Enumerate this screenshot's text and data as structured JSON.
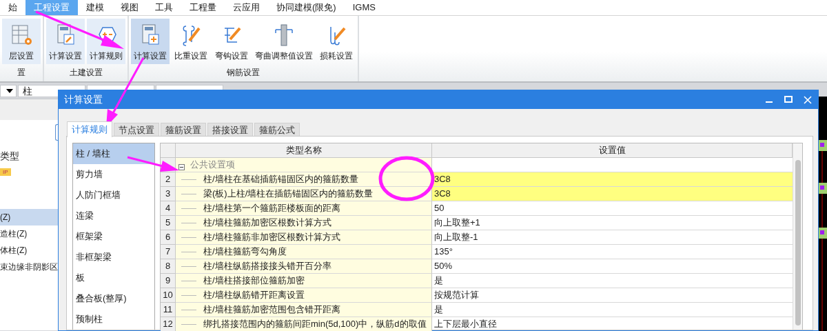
{
  "menu": [
    {
      "label": "始",
      "selected": false
    },
    {
      "label": "工程设置",
      "selected": true
    },
    {
      "label": "建模",
      "selected": false
    },
    {
      "label": "视图",
      "selected": false
    },
    {
      "label": "工具",
      "selected": false
    },
    {
      "label": "工程量",
      "selected": false
    },
    {
      "label": "云应用",
      "selected": false
    },
    {
      "label": "协同建模(限免)",
      "selected": false
    },
    {
      "label": "IGMS",
      "selected": false
    }
  ],
  "ribbon": {
    "groups": [
      {
        "label": "置",
        "buttons": [
          {
            "label": "层设置",
            "kind": "grid",
            "selected": false
          }
        ]
      },
      {
        "label": "土建设置",
        "buttons": [
          {
            "label": "计算设置",
            "kind": "wrench",
            "selected": false
          },
          {
            "label": "计算规则",
            "kind": "hexagon",
            "selected": false
          }
        ]
      },
      {
        "label": "钢筋设置",
        "buttons": [
          {
            "label": "计算设置",
            "kind": "calculator",
            "selected": true
          },
          {
            "label": "比重设置",
            "kind": "stirrup",
            "selected": false
          },
          {
            "label": "弯钩设置",
            "kind": "hook",
            "selected": false
          },
          {
            "label": "弯曲调整值设置",
            "kind": "column",
            "selected": false
          },
          {
            "label": "损耗设置",
            "kind": "bend",
            "selected": false
          }
        ]
      }
    ]
  },
  "toolbar": {
    "dropdowns": [
      {
        "value": "柱"
      }
    ]
  },
  "side_panel": {
    "heading": "类型",
    "tag": "IP",
    "items": [
      {
        "label": "(Z)",
        "selected": true
      },
      {
        "label": "造柱(Z)",
        "selected": false
      },
      {
        "label": "体柱(Z)",
        "selected": false
      },
      {
        "label": "束边缘非阴影区",
        "selected": false
      }
    ]
  },
  "dialog": {
    "title": "计算设置",
    "tabs": [
      {
        "label": "计算规则",
        "selected": true
      },
      {
        "label": "节点设置",
        "selected": false
      },
      {
        "label": "箍筋设置",
        "selected": false
      },
      {
        "label": "搭接设置",
        "selected": false
      },
      {
        "label": "箍筋公式",
        "selected": false
      }
    ],
    "categories": [
      {
        "label": "柱 / 墙柱",
        "selected": true
      },
      {
        "label": "剪力墙",
        "selected": false
      },
      {
        "label": "人防门框墙",
        "selected": false
      },
      {
        "label": "连梁",
        "selected": false
      },
      {
        "label": "框架梁",
        "selected": false
      },
      {
        "label": "非框架梁",
        "selected": false
      },
      {
        "label": "板",
        "selected": false
      },
      {
        "label": "叠合板(整厚)",
        "selected": false
      },
      {
        "label": "预制柱",
        "selected": false
      }
    ],
    "table": {
      "columns": [
        "类型名称",
        "设置值"
      ],
      "rows": [
        {
          "kind": "group",
          "name": "公共设置项",
          "expanded": true
        },
        {
          "kind": "item",
          "number": "2",
          "name": "柱/墙柱在基础插筋锚固区内的箍筋数量",
          "value": "3C8",
          "highlighted": true
        },
        {
          "kind": "item",
          "number": "3",
          "name": "梁(板)上柱/墙柱在插筋锚固区内的箍筋数量",
          "value": "3C8",
          "highlighted": true
        },
        {
          "kind": "item",
          "number": "4",
          "name": "柱/墙柱第一个箍筋距楼板面的距离",
          "value": "50",
          "highlighted": false
        },
        {
          "kind": "item",
          "number": "5",
          "name": "柱/墙柱箍筋加密区根数计算方式",
          "value": "向上取整+1",
          "highlighted": false
        },
        {
          "kind": "item",
          "number": "6",
          "name": "柱/墙柱箍筋非加密区根数计算方式",
          "value": "向上取整-1",
          "highlighted": false
        },
        {
          "kind": "item",
          "number": "7",
          "name": "柱/墙柱箍筋弯勾角度",
          "value": "135°",
          "highlighted": false
        },
        {
          "kind": "item",
          "number": "8",
          "name": "柱/墙柱纵筋搭接接头错开百分率",
          "value": "50%",
          "highlighted": false
        },
        {
          "kind": "item",
          "number": "9",
          "name": "柱/墙柱搭接部位箍筋加密",
          "value": "是",
          "highlighted": false
        },
        {
          "kind": "item",
          "number": "10",
          "name": "柱/墙柱纵筋错开距离设置",
          "value": "按规范计算",
          "highlighted": false
        },
        {
          "kind": "item",
          "number": "11",
          "name": "柱/墙柱箍筋加密范围包含错开距离",
          "value": "是",
          "highlighted": false
        },
        {
          "kind": "item",
          "number": "12",
          "name": "绑扎搭接范围内的箍筋间距min(5d,100)中，纵筋d的取值",
          "value": "上下层最小直径",
          "highlighted": false
        }
      ]
    }
  }
}
